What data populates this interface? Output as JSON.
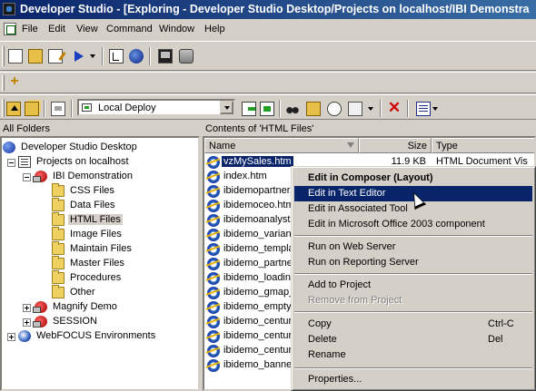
{
  "window": {
    "title": "Developer Studio - [Exploring - Developer Studio Desktop/Projects on localhost/IBI Demonstra"
  },
  "menubar": {
    "items": [
      "File",
      "Edit",
      "View",
      "Command",
      "Window",
      "Help"
    ]
  },
  "deploy_select": {
    "value": "Local Deploy"
  },
  "left_pane": {
    "header": "All Folders",
    "tree": {
      "root": "Developer Studio Desktop",
      "projects_host": "Projects on localhost",
      "ibi_demo": "IBI Demonstration",
      "ibi_children": [
        "CSS Files",
        "Data Files",
        "HTML Files",
        "Image Files",
        "Maintain Files",
        "Master Files",
        "Procedures",
        "Other"
      ],
      "magnify": "Magnify Demo",
      "session": "SESSION",
      "webfocus": "WebFOCUS Environments"
    }
  },
  "right_pane": {
    "header": "Contents of 'HTML Files'",
    "columns": {
      "name": "Name",
      "size": "Size",
      "type": "Type"
    },
    "files": [
      {
        "name": "vzMySales.htm",
        "size": "11.9 KB",
        "type": "HTML Document Vis"
      },
      {
        "name": "index.htm"
      },
      {
        "name": "ibidemopartner.h"
      },
      {
        "name": "ibidemoceo.htm"
      },
      {
        "name": "ibidemoanalyst.h"
      },
      {
        "name": "ibidemo_varianc"
      },
      {
        "name": "ibidemo_templat"
      },
      {
        "name": "ibidemo_partner"
      },
      {
        "name": "ibidemo_loading"
      },
      {
        "name": "ibidemo_gmap_"
      },
      {
        "name": "ibidemo_emptyr"
      },
      {
        "name": "ibidemo_century"
      },
      {
        "name": "ibidemo_century"
      },
      {
        "name": "ibidemo_century"
      },
      {
        "name": "ibidemo_banner"
      }
    ]
  },
  "context_menu": {
    "edit_composer": "Edit in Composer (Layout)",
    "edit_text": "Edit in Text Editor",
    "edit_assoc": "Edit in Associated Tool",
    "edit_office": "Edit in Microsoft Office 2003 component",
    "run_web": "Run on Web Server",
    "run_reporting": "Run on Reporting Server",
    "add_project": "Add to Project",
    "remove_project": "Remove from Project",
    "copy": "Copy",
    "copy_shortcut": "Ctrl-C",
    "delete": "Delete",
    "delete_shortcut": "Del",
    "rename": "Rename",
    "properties": "Properties..."
  }
}
